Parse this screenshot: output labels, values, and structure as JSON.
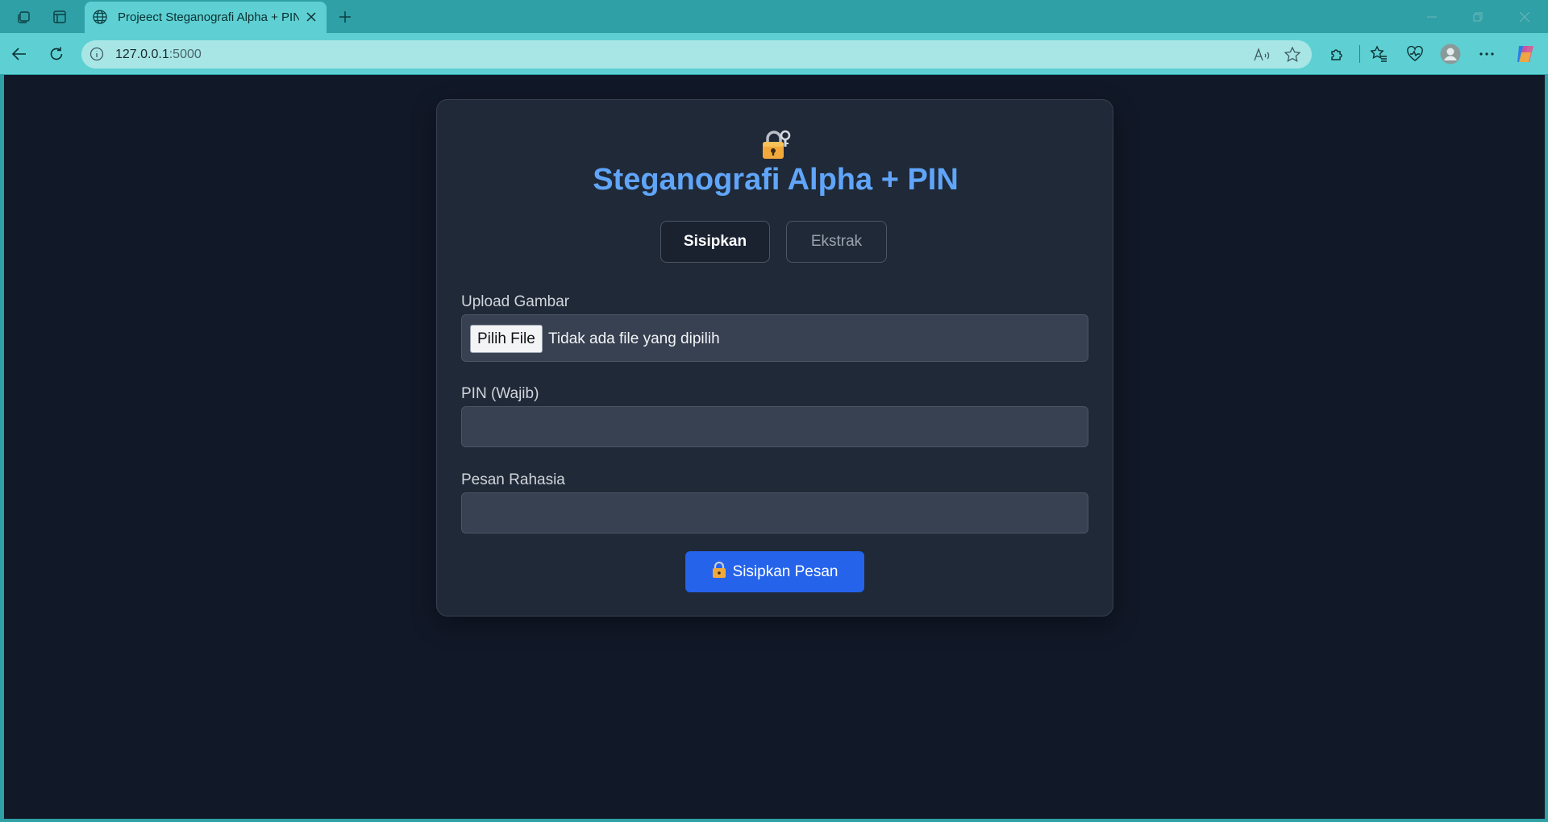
{
  "browser": {
    "tab_title": "Projeect Steganografi Alpha + PIN",
    "url_host": "127.0.0.1",
    "url_port": ":5000"
  },
  "app": {
    "title": "Steganografi Alpha + PIN",
    "tabs": [
      {
        "label": "Sisipkan",
        "active": true
      },
      {
        "label": "Ekstrak",
        "active": false
      }
    ],
    "upload": {
      "label": "Upload Gambar",
      "button_label": "Pilih File",
      "status": "Tidak ada file yang dipilih"
    },
    "pin": {
      "label": "PIN (Wajib)",
      "value": ""
    },
    "message": {
      "label": "Pesan Rahasia",
      "value": ""
    },
    "submit_label": "Sisipkan Pesan"
  },
  "colors": {
    "accent": "#60a5fa",
    "button": "#2563eb",
    "page_bg": "#111827",
    "card_bg": "#1f2937"
  },
  "icons": [
    "workspaces-icon",
    "tab-actions-icon",
    "globe-icon",
    "close-icon",
    "new-tab-icon",
    "back-icon",
    "refresh-icon",
    "info-icon",
    "read-aloud-icon",
    "favorite-star-icon",
    "extensions-icon",
    "favorites-icon",
    "health-icon",
    "profile-icon",
    "more-icon",
    "copilot-icon",
    "lock-icon"
  ]
}
